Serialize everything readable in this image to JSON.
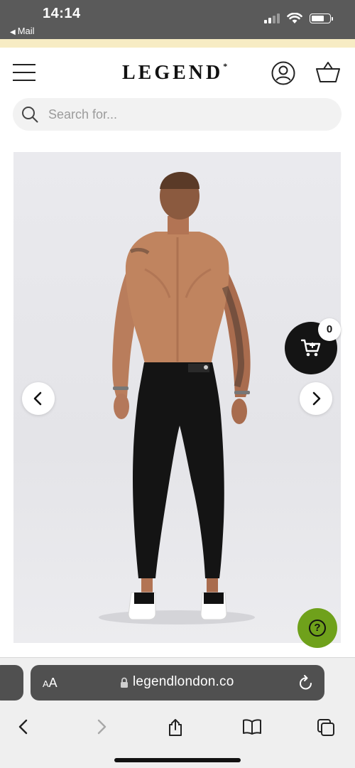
{
  "status_bar": {
    "time": "14:14",
    "back_label": "Mail"
  },
  "header": {
    "logo": "LEGEND",
    "logo_mark": "*"
  },
  "search": {
    "placeholder": "Search for..."
  },
  "product": {
    "image_alt": "Model wearing black skinny jeans, back view"
  },
  "cart": {
    "count": "0"
  },
  "help": {
    "symbol": "?"
  },
  "browser": {
    "text_size_label": "A",
    "text_size_label_small": "A",
    "url": "legendlondon.co"
  },
  "colors": {
    "help_green": "#6fa11b",
    "cart_black": "#141414",
    "promo_strip": "#f7ecc4"
  }
}
